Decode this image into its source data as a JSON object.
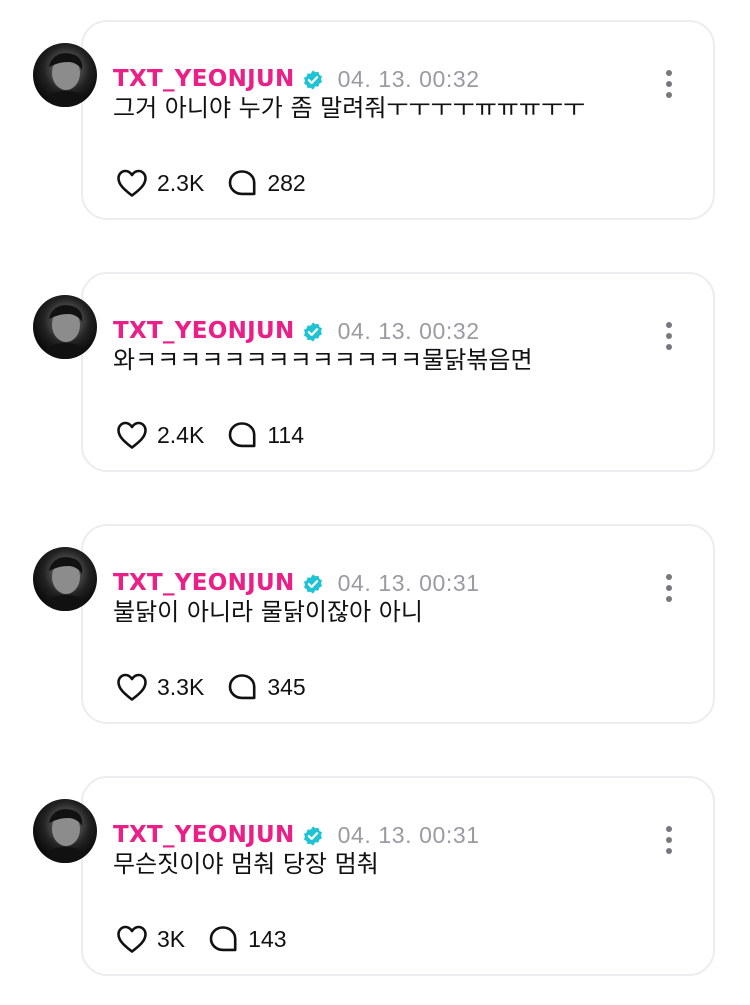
{
  "theme": {
    "username_color": "#ea1f88",
    "verified_color": "#1ec4d6",
    "border_color": "#ececf1",
    "muted_color": "#9a9aa2"
  },
  "icons": {
    "verified": "verified-badge-icon",
    "more": "more-vertical-icon",
    "like": "heart-icon",
    "reply": "speech-bubble-icon"
  },
  "posts": [
    {
      "username": "TXT_YEONJUN",
      "timestamp": "04. 13. 00:32",
      "text": "그거 아니야 누가 좀 말려줘ㅜㅜㅜㅜㅠㅠㅠㅜㅜ",
      "likes": "2.3K",
      "replies": "282"
    },
    {
      "username": "TXT_YEONJUN",
      "timestamp": "04. 13. 00:32",
      "text": "와ㅋㅋㅋㅋㅋㅋㅋㅋㅋㅋㅋㅋㅋ물닭볶음면",
      "likes": "2.4K",
      "replies": "114"
    },
    {
      "username": "TXT_YEONJUN",
      "timestamp": "04. 13. 00:31",
      "text": "불닭이 아니라 물닭이잖아 아니",
      "likes": "3.3K",
      "replies": "345"
    },
    {
      "username": "TXT_YEONJUN",
      "timestamp": "04. 13. 00:31",
      "text": "무슨짓이야 멈춰 당장 멈춰",
      "likes": "3K",
      "replies": "143"
    }
  ]
}
